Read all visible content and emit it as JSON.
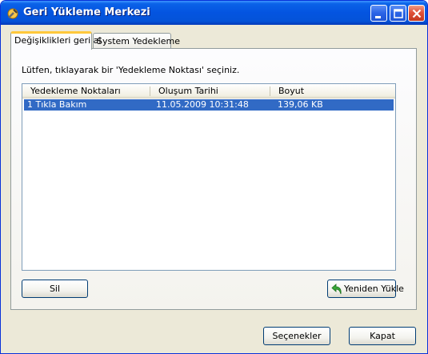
{
  "window": {
    "title": "Geri Yükleme Merkezi",
    "icon": "app-tools-icon",
    "controls": [
      "minimize-icon",
      "maximize-icon",
      "close-icon"
    ]
  },
  "tabs": [
    {
      "label": "Değişiklikleri geri al",
      "active": true
    },
    {
      "label": "System Yedekleme",
      "active": false
    }
  ],
  "instruction": "Lütfen, tıklayarak bir 'Yedekleme Noktası' seçiniz.",
  "list": {
    "columns": [
      "Yedekleme Noktaları",
      "Oluşum Tarihi",
      "Boyut"
    ],
    "rows": [
      {
        "name": "1 Tıkla Bakım",
        "date": "11.05.2009 10:31:48",
        "size": "139,06 KB",
        "selected": true
      }
    ]
  },
  "buttons": {
    "delete": "Sil",
    "restore": "Yeniden Yükle",
    "options": "Seçenekler",
    "close": "Kapat"
  },
  "colors": {
    "titlebar": "#0454e0",
    "selection": "#316ac5",
    "active_tab_accent": "#ffc83c"
  }
}
